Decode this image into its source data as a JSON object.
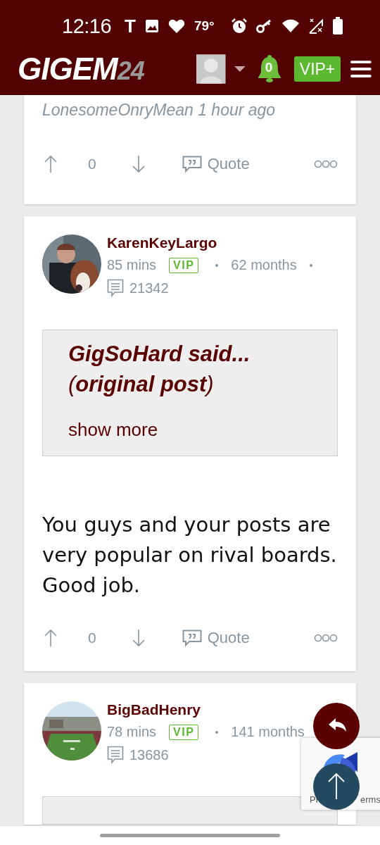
{
  "status_bar": {
    "time": "12:16",
    "app_letter": "T",
    "temperature": "79°"
  },
  "app_bar": {
    "logo": "GIGEM",
    "logo_suffix": "24",
    "notification_count": "0",
    "vip_button": "VIP+"
  },
  "posts": [
    {
      "kind": "tail",
      "signature": "LonesomeOnryMean 1 hour ago",
      "votes": "0",
      "quote_label": "Quote"
    },
    {
      "kind": "full",
      "username": "KarenKeyLargo",
      "time": "85 mins",
      "badge": "VIP",
      "tenure": "62 months",
      "tenure_dot": true,
      "post_count": "21342",
      "quote": {
        "title": "GigSoHard said...",
        "subtitle": "(**original post**)",
        "show_more": "show more"
      },
      "body": "You guys and your posts are very popular on rival boards. Good job.",
      "votes": "0",
      "quote_label": "Quote"
    },
    {
      "kind": "head",
      "username": "BigBadHenry",
      "time": "78 mins",
      "badge": "VIP",
      "tenure": "141 months",
      "tenure_dot": false,
      "post_count": "13686",
      "quote_cut": true
    }
  ],
  "recaptcha": {
    "left_text": "Pr",
    "right_text": "erms"
  }
}
